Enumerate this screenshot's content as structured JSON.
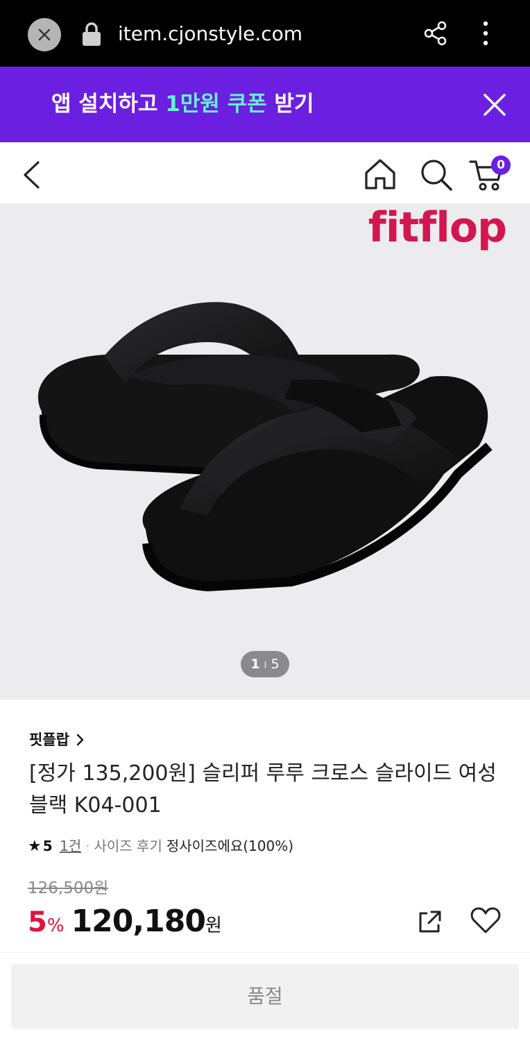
{
  "browser": {
    "url": "item.cjonstyle.com"
  },
  "promo": {
    "text_before": "앱 설치하고 ",
    "highlight": "1만원 쿠폰",
    "text_after": " 받기"
  },
  "header": {
    "cart_count": "0"
  },
  "gallery": {
    "logo": "fitflop",
    "current": "1",
    "separator": "I",
    "total": "5"
  },
  "product": {
    "brand": "핏플랍",
    "title": "[정가 135,200원] 슬리퍼 루루 크로스 슬라이드 여성 블랙 K04-001",
    "rating": {
      "score": "5",
      "count": "1건",
      "size_label": "사이즈 후기",
      "size_value": "정사이즈에요(100%)"
    },
    "original_price": "126,500원",
    "discount": "5",
    "discount_unit": "%",
    "sale_price": "120,180",
    "currency": "원"
  },
  "actions": {
    "soldout_label": "품절"
  },
  "colors": {
    "promo_bg": "#6b1fe0",
    "promo_highlight": "#67f0d3",
    "discount": "#e0123c",
    "brand_logo": "#d4164f"
  }
}
